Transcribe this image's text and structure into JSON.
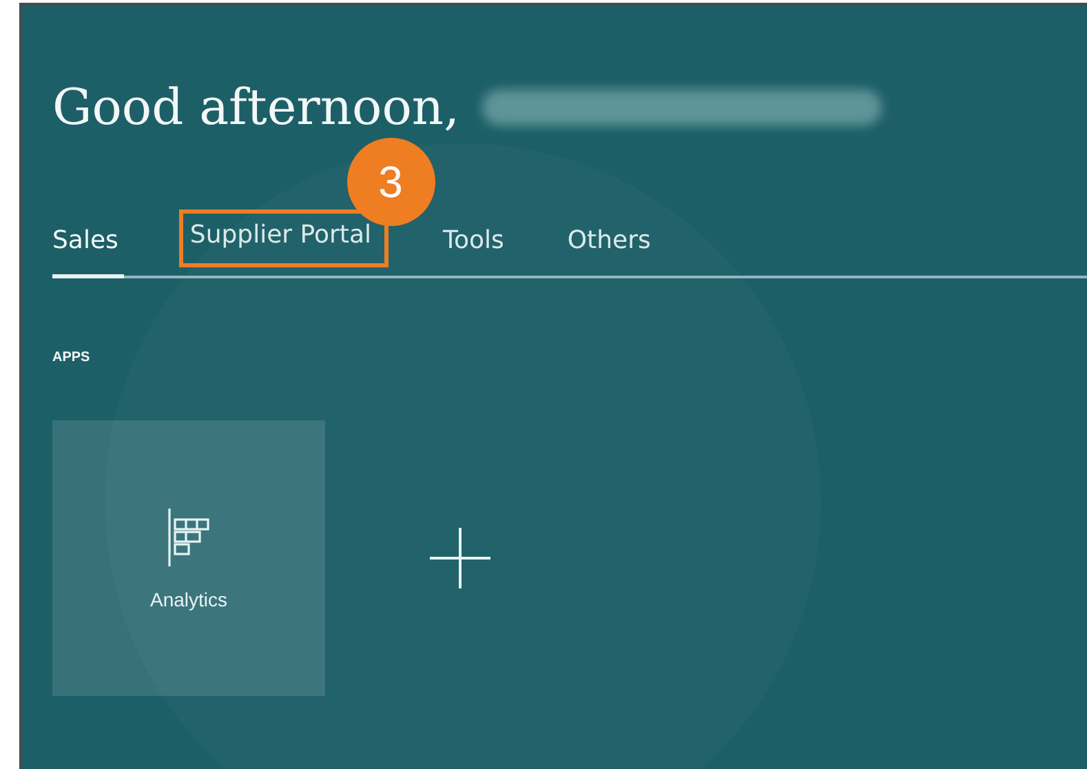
{
  "greeting": "Good afternoon,",
  "tabs": [
    {
      "label": "Sales",
      "selected": true,
      "highlighted": false
    },
    {
      "label": "Supplier Portal",
      "selected": false,
      "highlighted": true,
      "callout": "3"
    },
    {
      "label": "Tools",
      "selected": false,
      "highlighted": false
    },
    {
      "label": "Others",
      "selected": false,
      "highlighted": false
    }
  ],
  "section_title": "APPS",
  "apps": [
    {
      "kind": "app",
      "label": "Analytics"
    },
    {
      "kind": "add"
    }
  ]
}
